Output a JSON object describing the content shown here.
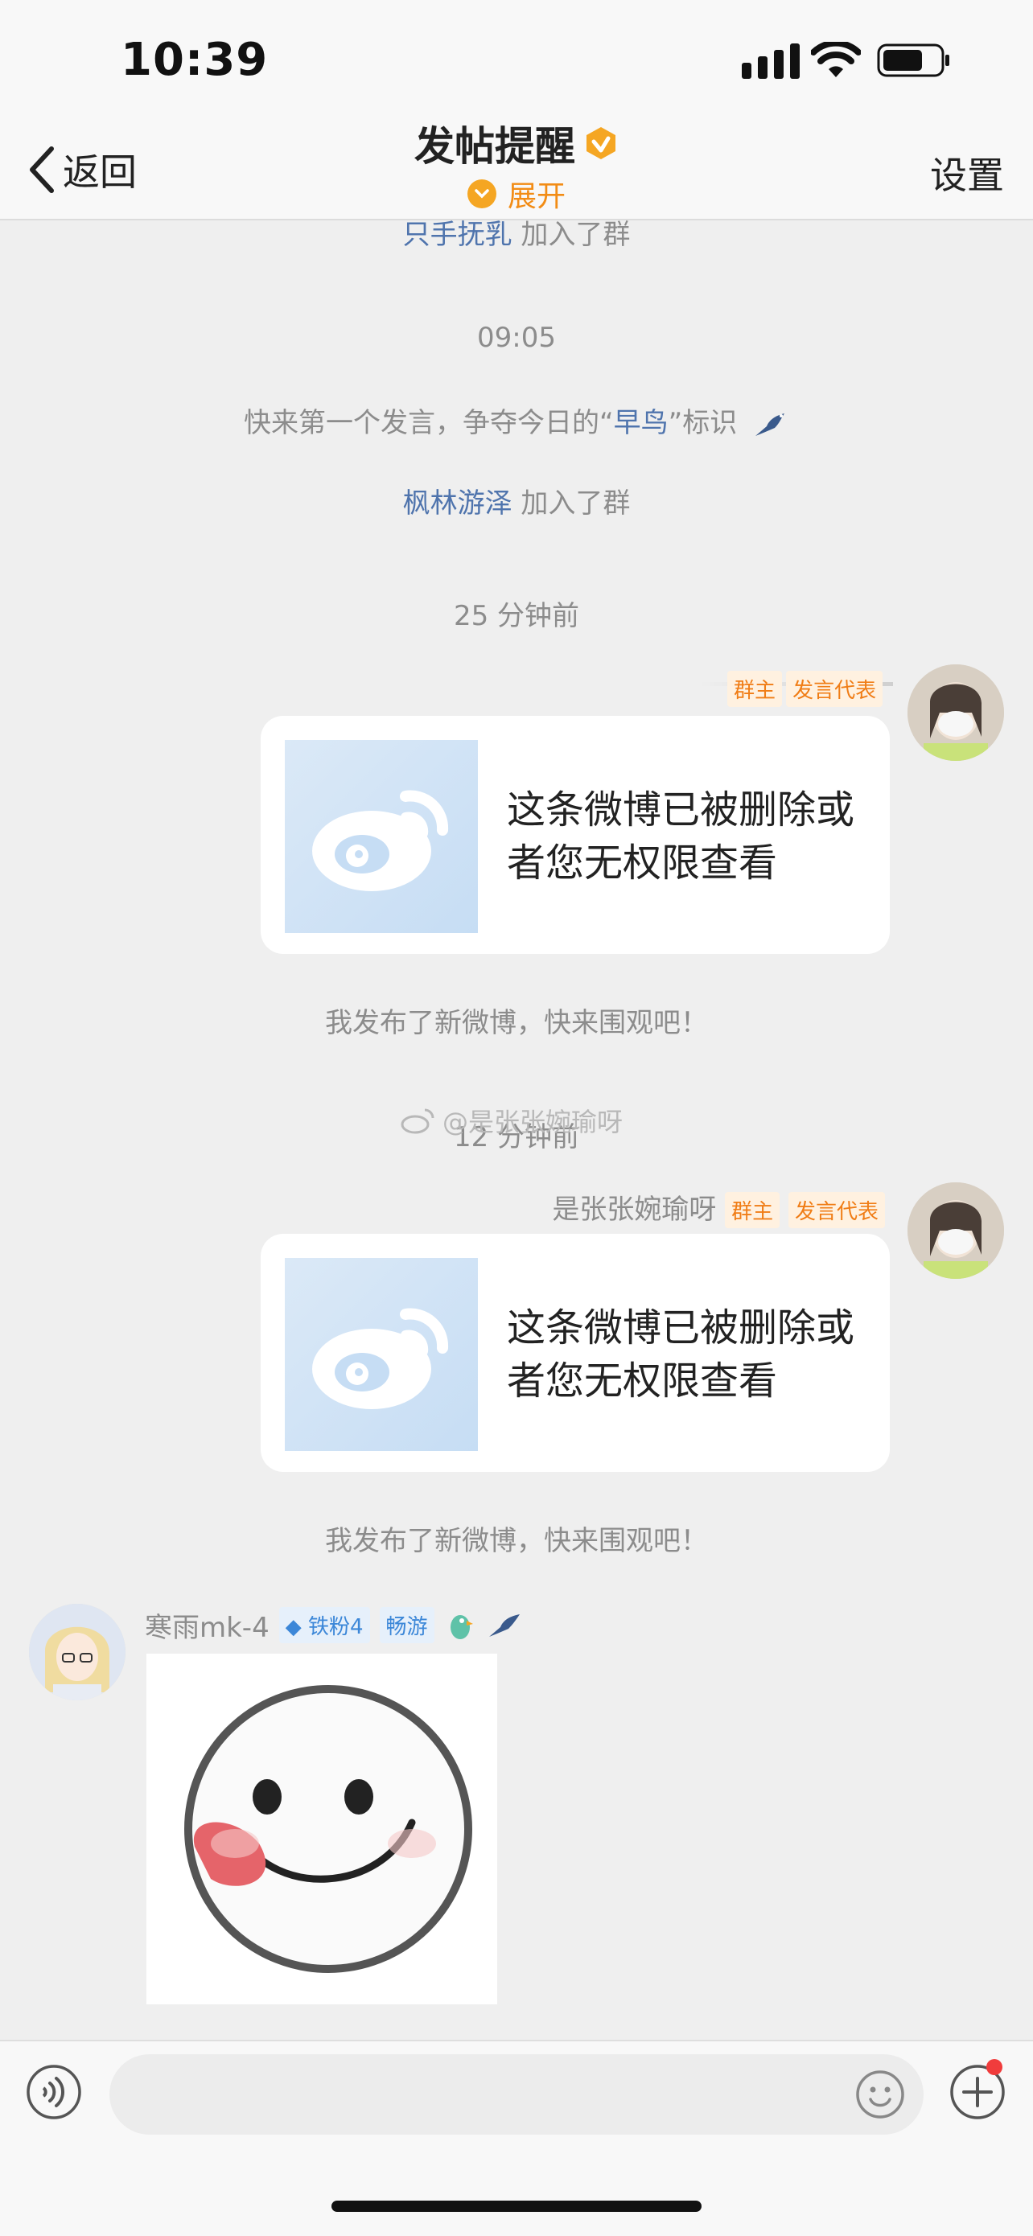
{
  "status_bar": {
    "time": "10:39"
  },
  "header": {
    "back_label": "返回",
    "title": "发帖提醒",
    "expand_label": "展开",
    "settings_label": "设置"
  },
  "chat": {
    "top_partial_name": "只手抚乳",
    "top_partial_suffix": "加入了群",
    "timestamp_1": "09:05",
    "early_bird_prefix": "快来第一个发言，争夺今日的“",
    "early_bird_word": "早鸟",
    "early_bird_suffix": "”标识",
    "join_name": "枫林游泽",
    "join_suffix": "加入了群",
    "timestamp_2": "25 分钟前",
    "msg1": {
      "tag_owner": "群主",
      "tag_rep": "发言代表",
      "card_text": "这条微博已被删除或者您无权限查看",
      "caption": "我发布了新微博，快来围观吧！"
    },
    "timestamp_3": "12 分钟前",
    "watermark": "@是张张婉瑜呀",
    "msg2": {
      "name": "是张张婉瑜呀",
      "tag_owner": "群主",
      "tag_rep": "发言代表",
      "card_text": "这条微博已被删除或者您无权限查看",
      "caption": "我发布了新微博，快来围观吧！"
    },
    "msg3": {
      "name": "寒雨mk-4",
      "tag_fan": "铁粉4",
      "tag_swim": "畅游"
    }
  },
  "colors": {
    "accent": "#f28c15",
    "link": "#4f74ad",
    "background": "#efefef"
  }
}
